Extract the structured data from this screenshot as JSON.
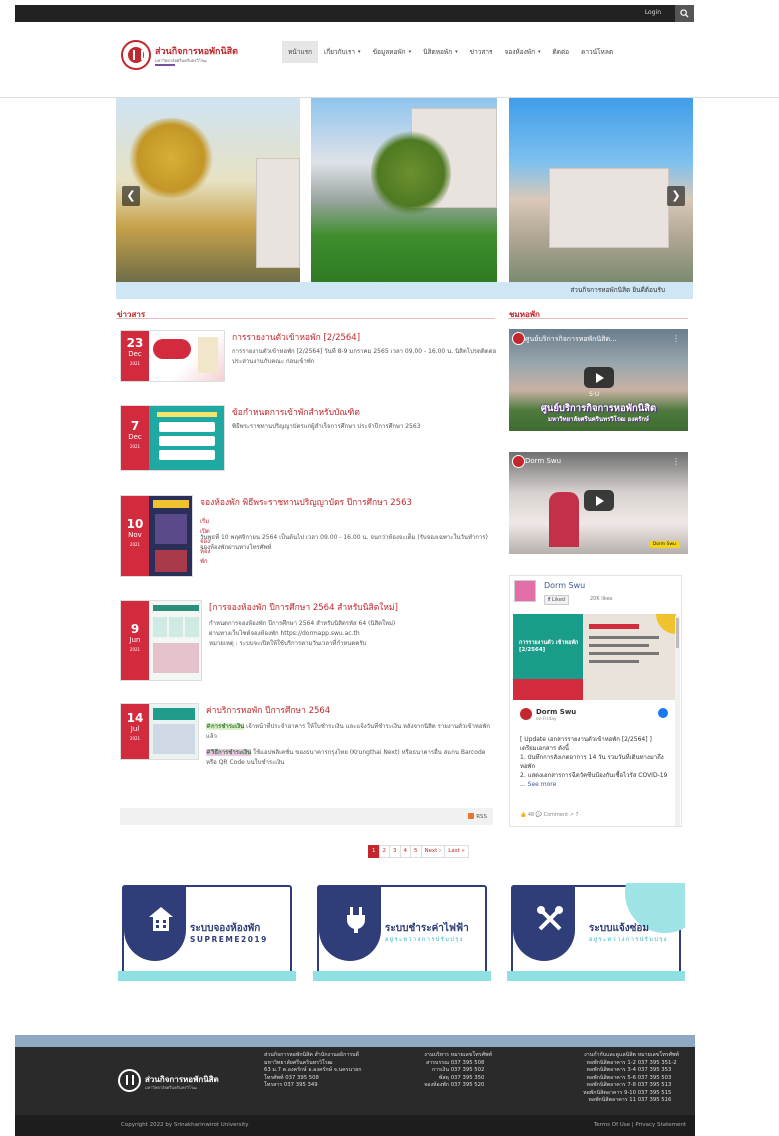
{
  "topbar": {
    "login": "Login"
  },
  "header": {
    "brand": "ส่วนกิจการหอพักนิสิต",
    "brand_sub": "มหาวิทยาลัยศรีนครินทรวิโรฒ",
    "nav": [
      {
        "label": "หน้าแรก",
        "active": true,
        "dropdown": false
      },
      {
        "label": "เกี่ยวกับเรา",
        "dropdown": true
      },
      {
        "label": "ข้อมูลหอพัก",
        "dropdown": true
      },
      {
        "label": "นิสิตหอพัก",
        "dropdown": true
      },
      {
        "label": "ข่าวสาร",
        "dropdown": false
      },
      {
        "label": "จองห้องพัก",
        "dropdown": true
      },
      {
        "label": "ติดต่อ",
        "dropdown": false
      },
      {
        "label": "ดาวน์โหลด",
        "dropdown": false
      }
    ]
  },
  "slider": {
    "caption": "ส่วนกิจการหอพักนิสิต ยินดีต้อนรับ",
    "prev": "❮",
    "next": "❯"
  },
  "news": {
    "title": "ข่าวสาร",
    "items": [
      {
        "day": "23",
        "month": "Dec",
        "year": "2021",
        "title": "การรายงานตัวเข้าหอพัก [2/2564]",
        "text": "การรายงานตัวเข้าหอพัก [2/2564] วันที่ 8-9 มกราคม 2565 เวลา 09.00 - 16.00 น. นิสิตโปรดติดต่อประสานงานกับคณะ ก่อนเข้าพัก"
      },
      {
        "day": "7",
        "month": "Dec",
        "year": "2021",
        "title": "ข้อกำหนดการเข้าพักสำหรับบัณฑิต",
        "text": "พิธีพระราชทานปริญญาบัตรแก่ผู้สำเร็จการศึกษา ประจำปีการศึกษา 2563"
      },
      {
        "day": "10",
        "month": "Nov",
        "year": "2021",
        "title": "จองห้องพัก พิธีพระราชทานปริญญาบัตร ปีการศึกษา 2563",
        "sub": "เริ่มเปิดจองห้องพัก",
        "text": "วันพุธที่ 10 พฤศจิกายน 2564 เป็นต้นไป เวลา 09.00 - 16.00 น. จนกว่าห้องจะเต็ม (รับจองเฉพาะในวันทำการ) จองห้องพักผ่านทางโทรศัพท์"
      },
      {
        "day": "9",
        "month": "Jun",
        "year": "2021",
        "title": "[การจองห้องพัก ปีการศึกษา 2564 สำหรับนิสิตใหม่]",
        "text1": "กำหนดการจองห้องพัก ปีการศึกษา 2564 สำหรับนิสิตรหัส 64 (นิสิตใหม่)",
        "text2": "ผ่านทางเว็บไซต์จองห้องพัก https://dormapp.swu.ac.th",
        "text3": "หมายเหตุ : ระบบจะเปิดให้ใช้บริการตามวันเวลาที่กำหนดครับ"
      },
      {
        "day": "14",
        "month": "Jul",
        "year": "2021",
        "title": "ค่าบริการหอพัก ปีการศึกษา 2564",
        "hl1": "#การชำระเงิน",
        "text1": " เจ้าหน้าที่ประจำอาคาร ให้ใบชำระเงิน และแจ้งวันที่ชำระเงิน หลังจากนิสิต รายงานตัวเข้าหอพักแล้ว",
        "hl2": "#วิธีการชำระเงิน",
        "text2": " ใช้แอปพลิเคชั่น ของธนาคารกรุงไทย (Krungthai Next) หรือธนาคารอื่น สแกน Barcode หรือ QR Code บนใบชำระเงิน"
      }
    ],
    "rss": "RSS"
  },
  "pager": [
    "1",
    "2",
    "3",
    "4",
    "5",
    "Next ›",
    "Last »"
  ],
  "sidebar": {
    "title": "ชมหอพัก",
    "video1": {
      "title": "ศูนย์บริการกิจการหอพักนิสิต...",
      "big": "ศูนย์บริการกิจการหอพักนิสิต",
      "big2": "มหาวิทยาลัยศรีนครินทรวิโรฒ องครักษ์",
      "logo": "S·U"
    },
    "video2": {
      "title": "Dorm Swu",
      "label": "Dorm Swu"
    },
    "fb": {
      "name": "Dorm Swu",
      "liked": "Liked",
      "likes": "20K likes",
      "img_text": "การรายงานตัว เข้าหอพัก [2/2564]",
      "page_name": "Dorm Swu",
      "time": "on Friday",
      "post": "[ Update เอกสารรายงานตัวเข้าหอพัก [2/2564] ]",
      "post2": "เตรียมเอกสาร ดังนี้",
      "post3": "1. บันทึกการสังเกตอาการ 14 วัน รวมวันที่เดินทางมาถึงหอพัก",
      "post4": "2. แสดงเอกสารการฉีดวัคซีนป้องกันเชื้อไวรัส COVID-19 ...",
      "see_more": "See more",
      "stats": "👍 48    💬 Comment    ↗ 7"
    }
  },
  "banners": [
    {
      "title": "ระบบจองห้องพัก",
      "sub": "SUPREME2019"
    },
    {
      "title": "ระบบชำระค่าไฟฟ้า",
      "sub2": "อยู่ระหว่างการปรับปรุง"
    },
    {
      "title": "ระบบแจ้งซ่อม",
      "sub2": "อยู่ระหว่างการปรับปรุง"
    }
  ],
  "footer": {
    "brand": "ส่วนกิจการหอพักนิสิต",
    "brand_sub": "มหาวิทยาลัยศรีนครินทรวิโรฒ",
    "address": [
      "ส่วนกิจการหอพักนิสิต สำนักงานอธิการบดี",
      "มหาวิทยาลัยศรีนครินทรวิโรฒ",
      "63 ม.7 ต.องครักษ์ อ.องครักษ์ จ.นครนายก",
      "โทรศัพท์ 037 395 508",
      "โทรสาร 037 395 349"
    ],
    "contacts_head": [
      "งานบริหาร",
      "หมายเลขโทรศัพท์"
    ],
    "contacts": [
      [
        "สารบรรณ",
        "037 395 508"
      ],
      [
        "การเงิน",
        "037 395 502"
      ],
      [
        "พัสดุ",
        "037 395 350"
      ],
      [
        "จองห้องพัก",
        "037 395 520"
      ]
    ],
    "dorms_head": [
      "งานกำกับและดูแลนิสิต",
      "หมายเลขโทรศัพท์"
    ],
    "dorms": [
      [
        "หอพักนิสิตอาคาร 1-2",
        "037 395 351-2"
      ],
      [
        "หอพักนิสิตอาคาร 3-4",
        "037 395 353"
      ],
      [
        "หอพักนิสิตอาคาร 5-6",
        "037 395 503"
      ],
      [
        "หอพักนิสิตอาคาร 7-8",
        "037 395 513"
      ],
      [
        "หอพักนิสิตอาคาร 9-10",
        "037 395 515"
      ],
      [
        "หอพักนิสิตอาคาร 11",
        "037 395 516"
      ]
    ],
    "copyright": "Copyright 2022 by Srinakharinwirot University",
    "terms": "Terms Of Use | Privacy Statement"
  }
}
